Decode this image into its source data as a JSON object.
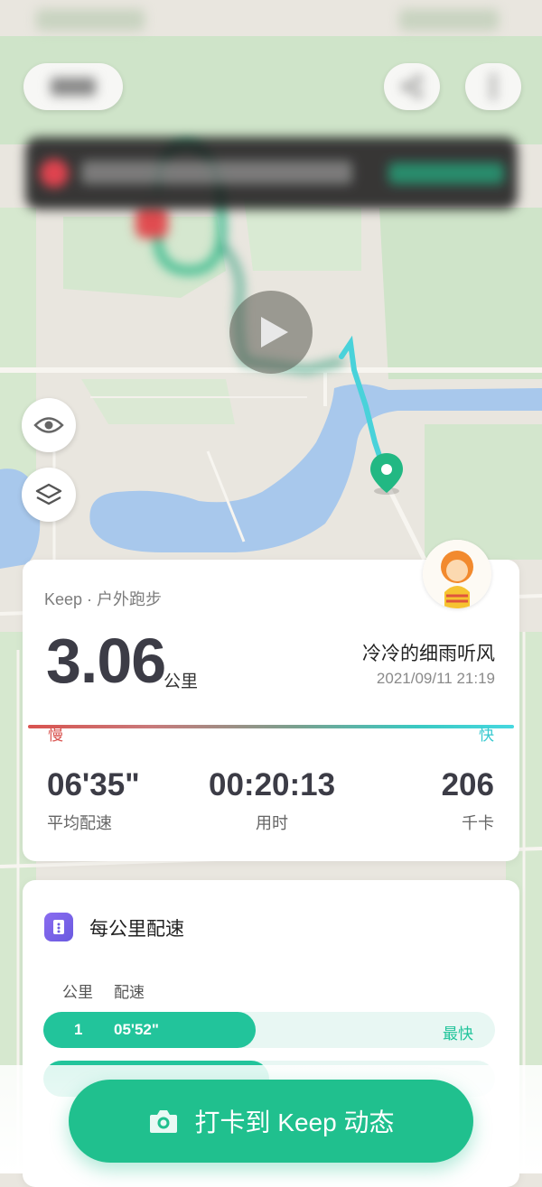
{
  "summary": {
    "source": "Keep · 户外跑步",
    "distance": "3.06",
    "distance_unit": "公里",
    "username": "冷冷的细雨听风",
    "datetime": "2021/09/11 21:19",
    "slow_label": "慢",
    "fast_label": "快",
    "stats": {
      "avg_pace_value": "06'35\"",
      "avg_pace_label": "平均配速",
      "duration_value": "00:20:13",
      "duration_label": "用时",
      "calories_value": "206",
      "calories_label": "千卡"
    }
  },
  "pace_card": {
    "title": "每公里配速",
    "col_km": "公里",
    "col_pace": "配速",
    "rows": [
      {
        "km": "1",
        "pace": "05'52\"",
        "tag": "最快",
        "fill_fraction": 0.47
      },
      {
        "km": "",
        "pace": "",
        "tag": "",
        "fill_fraction": 0.5
      }
    ]
  },
  "cta": {
    "label": "打卡到 Keep 动态",
    "icon": "camera-icon"
  },
  "colors": {
    "accent": "#20c08e",
    "route": "#3ad0c0",
    "slow": "#d9534f",
    "fast": "#38c9d0"
  }
}
